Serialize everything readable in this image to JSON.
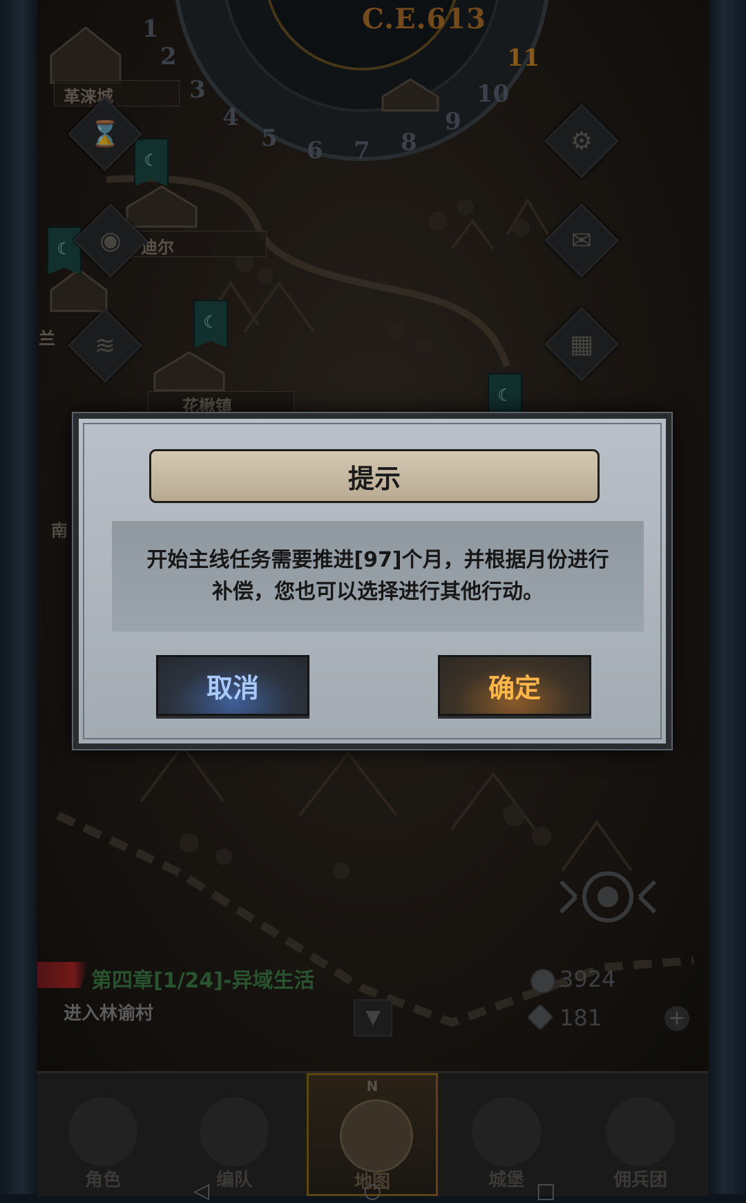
{
  "calendar": {
    "year_label": "C.E.613",
    "months": [
      "1",
      "2",
      "3",
      "4",
      "5",
      "6",
      "7",
      "8",
      "9",
      "10",
      "11"
    ],
    "active_month": "11"
  },
  "map": {
    "places": {
      "city1": "革涞城",
      "town2": "迪尔",
      "town3": "花楸镇",
      "left_cut1": "兰",
      "left_cut2": "南"
    }
  },
  "quest": {
    "title": "第四章[1/24]-异域生活",
    "subtitle": "进入林谕村"
  },
  "resources": {
    "coins": "3924",
    "crystals": "181"
  },
  "dialog": {
    "title": "提示",
    "message": "开始主线任务需要推进[97]个月，并根据月份进行补偿，您也可以选择进行其他行动。",
    "cancel_label": "取消",
    "confirm_label": "确定"
  },
  "bottom_nav": {
    "compass_letter": "N",
    "items": [
      {
        "label": "角色"
      },
      {
        "label": "编队"
      },
      {
        "label": "地图"
      },
      {
        "label": "城堡"
      },
      {
        "label": "佣兵团"
      }
    ],
    "active_index": 2
  },
  "icons": {
    "settings": "gear-icon",
    "mail": "envelope-icon",
    "quests": "board-icon",
    "time": "hourglass-icon",
    "bag": "bag-icon",
    "scroll": "scroll-icon",
    "locate": "crosshair-icon",
    "add": "plus-icon"
  },
  "colors": {
    "year": "#b2722c",
    "active_month": "#d18a29",
    "quest_title": "#3f7f47",
    "cancel_text": "#a9c9ff",
    "confirm_text": "#ffb64a"
  }
}
